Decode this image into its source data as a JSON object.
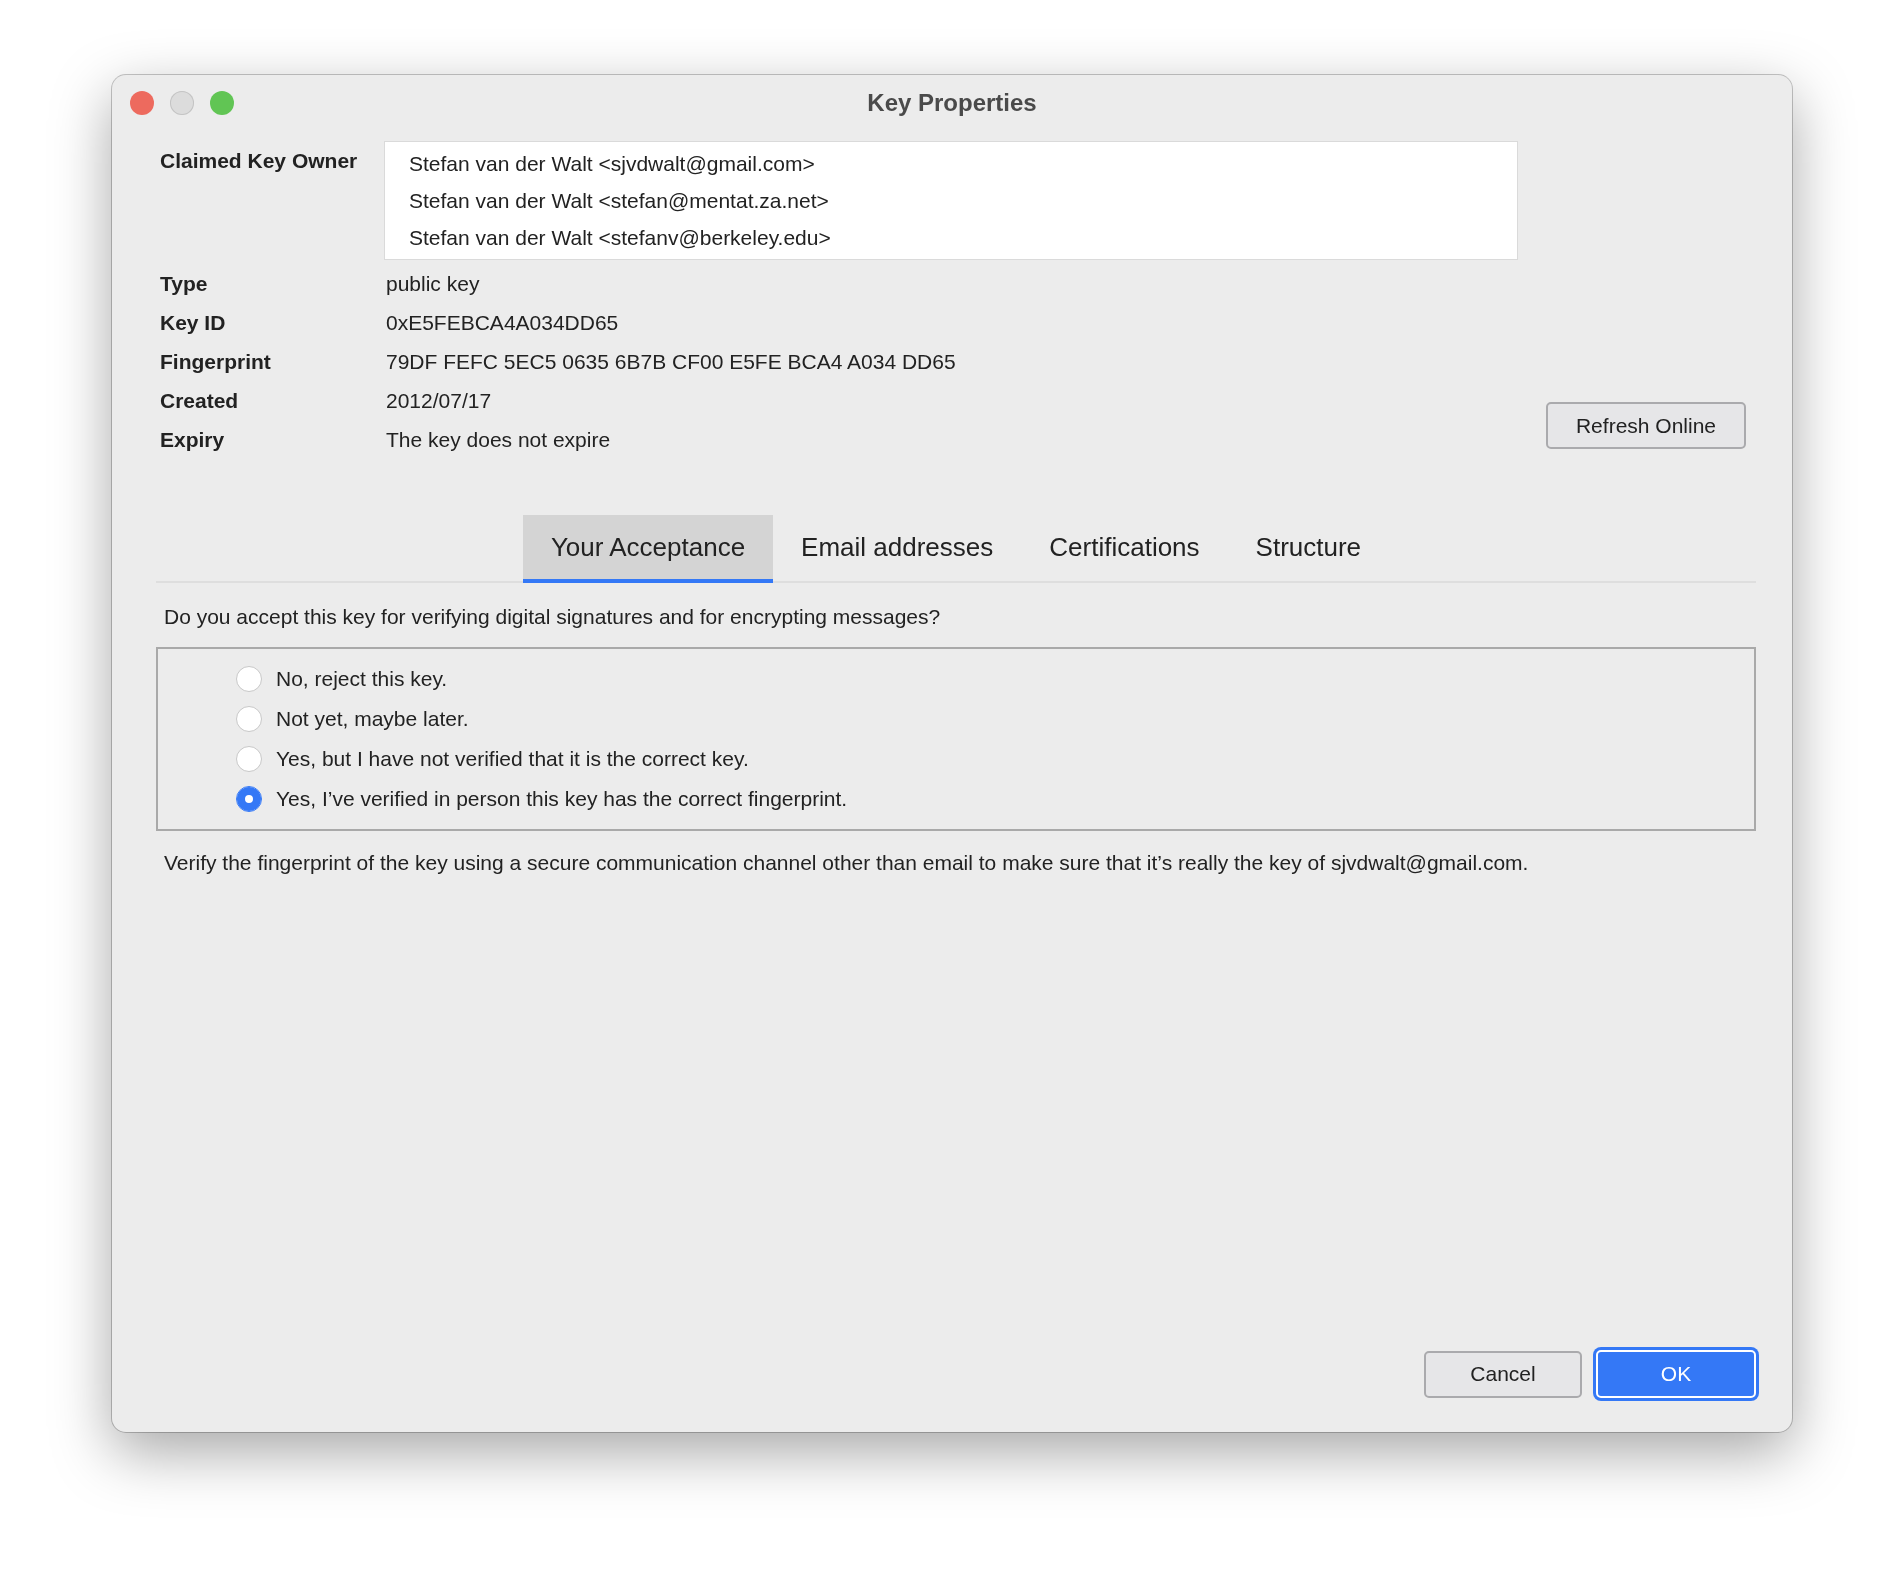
{
  "window": {
    "title": "Key Properties",
    "controls": [
      {
        "kind": "close",
        "disabled": false
      },
      {
        "kind": "minimize",
        "disabled": true
      },
      {
        "kind": "zoom",
        "disabled": false
      }
    ]
  },
  "claimed_key_owner": {
    "label": "Claimed Key Owner",
    "values": [
      "Stefan van der Walt <sjvdwalt@gmail.com>",
      "Stefan van der Walt <stefan@mentat.za.net>",
      "Stefan van der Walt <stefanv@berkeley.edu>"
    ]
  },
  "properties": [
    {
      "label": "Type",
      "value": "public key"
    },
    {
      "label": "Key ID",
      "value": "0xE5FEBCA4A034DD65"
    },
    {
      "label": "Fingerprint",
      "value": "79DF FEFC 5EC5 0635 6B7B CF00 E5FE BCA4 A034 DD65"
    },
    {
      "label": "Created",
      "value": "2012/07/17"
    },
    {
      "label": "Expiry",
      "value": "The key does not expire"
    }
  ],
  "refresh_button": "Refresh Online",
  "tabs": [
    {
      "label": "Your Acceptance",
      "selected": true
    },
    {
      "label": "Email addresses",
      "selected": false
    },
    {
      "label": "Certifications",
      "selected": false
    },
    {
      "label": "Structure",
      "selected": false
    }
  ],
  "question": "Do you accept this key for verifying digital signatures and for encrypting messages?",
  "options": [
    {
      "label": "No, reject this key.",
      "selected": false
    },
    {
      "label": "Not yet, maybe later.",
      "selected": false
    },
    {
      "label": "Yes, but I have not verified that it is the correct key.",
      "selected": false
    },
    {
      "label": "Yes, I’ve verified in person this key has the correct fingerprint.",
      "selected": true
    }
  ],
  "note": "Verify the fingerprint of the key using a secure communication channel other than email to make sure that it’s really the key of sjvdwalt@gmail.com.",
  "buttons": [
    {
      "label": "Cancel",
      "kind": "normal"
    },
    {
      "label": "OK",
      "kind": "default"
    }
  ]
}
